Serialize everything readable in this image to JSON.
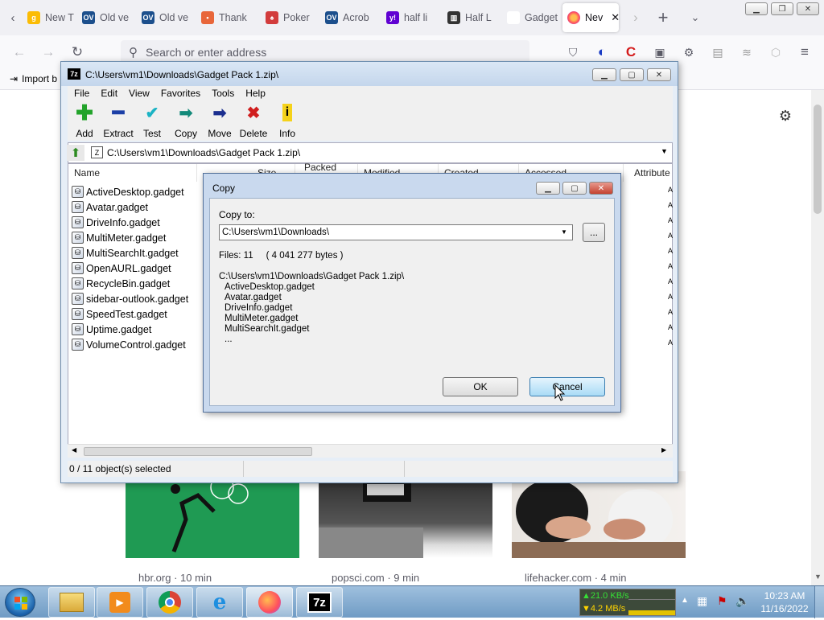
{
  "browser": {
    "tabs": [
      {
        "label": "New T",
        "fav": "g",
        "color": "#fbbc05"
      },
      {
        "label": "Old ve",
        "fav": "OV",
        "color": "#1c4f8c"
      },
      {
        "label": "Old ve",
        "fav": "OV",
        "color": "#1c4f8c"
      },
      {
        "label": "Thank",
        "fav": "•",
        "color": "#e8663a"
      },
      {
        "label": "Poker",
        "fav": "♠",
        "color": "#d23c3c"
      },
      {
        "label": "Acrob",
        "fav": "OV",
        "color": "#1c4f8c"
      },
      {
        "label": "half li",
        "fav": "y!",
        "color": "#6001d2"
      },
      {
        "label": "Half L",
        "fav": "▥",
        "color": "#333333"
      },
      {
        "label": "Gadget Pa",
        "fav": "",
        "color": "#ffffff"
      }
    ],
    "active_tab": {
      "label": "Nev"
    },
    "address_placeholder": "Search or enter address",
    "import_label": "Import b",
    "cards": [
      {
        "source": "hbr.org · 10 min"
      },
      {
        "source": "popsci.com · 9 min"
      },
      {
        "source": "lifehacker.com · 4 min"
      }
    ]
  },
  "sevenzip": {
    "title": "C:\\Users\\vm1\\Downloads\\Gadget Pack 1.zip\\",
    "app_icon": "7z",
    "menu": [
      "File",
      "Edit",
      "View",
      "Favorites",
      "Tools",
      "Help"
    ],
    "toolbar": [
      {
        "label": "Add",
        "icon": "+",
        "color": "#22a32a"
      },
      {
        "label": "Extract",
        "icon": "━",
        "color": "#1b3fa6"
      },
      {
        "label": "Test",
        "icon": "✔",
        "color": "#1bb3c4"
      },
      {
        "label": "Copy",
        "icon": "➡",
        "color": "#138a7a"
      },
      {
        "label": "Move",
        "icon": "➡",
        "color": "#1b2f8f"
      },
      {
        "label": "Delete",
        "icon": "✖",
        "color": "#d01e1e"
      },
      {
        "label": "Info",
        "icon": "i",
        "color": "#d4b300"
      }
    ],
    "path": "C:\\Users\\vm1\\Downloads\\Gadget Pack 1.zip\\",
    "columns": [
      "Name",
      "Size",
      "Packed Size",
      "Modified",
      "Created",
      "Accessed",
      "Attribute"
    ],
    "files": [
      "ActiveDesktop.gadget",
      "Avatar.gadget",
      "DriveInfo.gadget",
      "MultiMeter.gadget",
      "MultiSearchIt.gadget",
      "OpenAURL.gadget",
      "RecycleBin.gadget",
      "sidebar-outlook.gadget",
      "SpeedTest.gadget",
      "Uptime.gadget",
      "VolumeControl.gadget"
    ],
    "status": "0 / 11 object(s) selected"
  },
  "dialog": {
    "title": "Copy",
    "copy_to_label": "Copy to:",
    "copy_to_value": "C:\\Users\\vm1\\Downloads\\",
    "browse_label": "...",
    "files_info": "Files: 11     ( 4 041 277 bytes )",
    "source_path": "C:\\Users\\vm1\\Downloads\\Gadget Pack 1.zip\\",
    "items": [
      "ActiveDesktop.gadget",
      "Avatar.gadget",
      "DriveInfo.gadget",
      "MultiMeter.gadget",
      "MultiSearchIt.gadget",
      "..."
    ],
    "ok_label": "OK",
    "cancel_label": "Cancel"
  },
  "taskbar": {
    "net_up": "▲21.0 KB/s",
    "net_down": "▼4.2 MB/s",
    "time": "10:23 AM",
    "date": "11/16/2022",
    "apps": [
      "explorer-icon",
      "media-player-icon",
      "chrome-icon",
      "ie-icon",
      "firefox-icon",
      "7zip-icon"
    ]
  }
}
